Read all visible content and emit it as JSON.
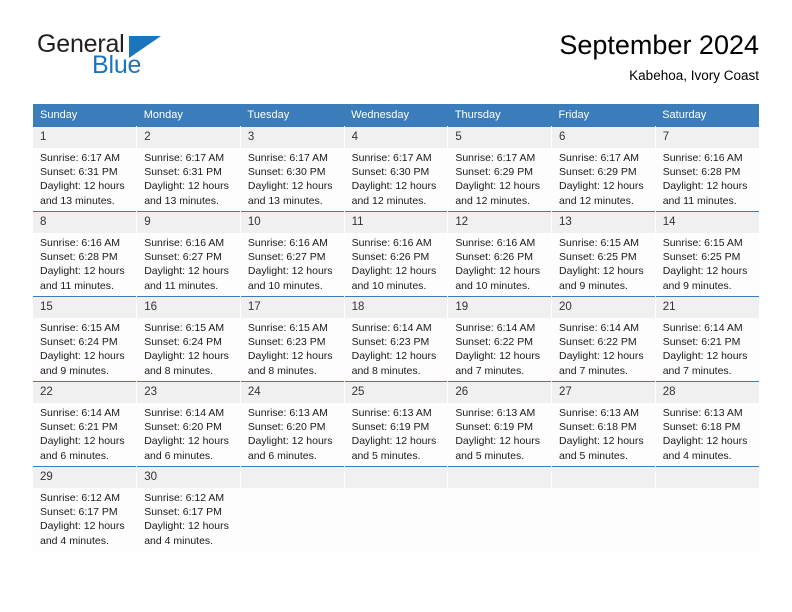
{
  "brand": {
    "name_top": "General",
    "name_bottom": "Blue",
    "accent_color": "#1b75bc",
    "triangle_icon": "logo-triangle-icon"
  },
  "header": {
    "title": "September 2024",
    "subtitle": "Kabehoa, Ivory Coast"
  },
  "calendar": {
    "header_background": "#3b7dba",
    "header_text_color": "#ffffff",
    "daynum_background": "#f0f0f0",
    "weekday_headers": [
      "Sunday",
      "Monday",
      "Tuesday",
      "Wednesday",
      "Thursday",
      "Friday",
      "Saturday"
    ],
    "weeks": [
      [
        {
          "day": "1",
          "sunrise": "Sunrise: 6:17 AM",
          "sunset": "Sunset: 6:31 PM",
          "daylight_1": "Daylight: 12 hours",
          "daylight_2": "and 13 minutes."
        },
        {
          "day": "2",
          "sunrise": "Sunrise: 6:17 AM",
          "sunset": "Sunset: 6:31 PM",
          "daylight_1": "Daylight: 12 hours",
          "daylight_2": "and 13 minutes."
        },
        {
          "day": "3",
          "sunrise": "Sunrise: 6:17 AM",
          "sunset": "Sunset: 6:30 PM",
          "daylight_1": "Daylight: 12 hours",
          "daylight_2": "and 13 minutes."
        },
        {
          "day": "4",
          "sunrise": "Sunrise: 6:17 AM",
          "sunset": "Sunset: 6:30 PM",
          "daylight_1": "Daylight: 12 hours",
          "daylight_2": "and 12 minutes."
        },
        {
          "day": "5",
          "sunrise": "Sunrise: 6:17 AM",
          "sunset": "Sunset: 6:29 PM",
          "daylight_1": "Daylight: 12 hours",
          "daylight_2": "and 12 minutes."
        },
        {
          "day": "6",
          "sunrise": "Sunrise: 6:17 AM",
          "sunset": "Sunset: 6:29 PM",
          "daylight_1": "Daylight: 12 hours",
          "daylight_2": "and 12 minutes."
        },
        {
          "day": "7",
          "sunrise": "Sunrise: 6:16 AM",
          "sunset": "Sunset: 6:28 PM",
          "daylight_1": "Daylight: 12 hours",
          "daylight_2": "and 11 minutes."
        }
      ],
      [
        {
          "day": "8",
          "sunrise": "Sunrise: 6:16 AM",
          "sunset": "Sunset: 6:28 PM",
          "daylight_1": "Daylight: 12 hours",
          "daylight_2": "and 11 minutes."
        },
        {
          "day": "9",
          "sunrise": "Sunrise: 6:16 AM",
          "sunset": "Sunset: 6:27 PM",
          "daylight_1": "Daylight: 12 hours",
          "daylight_2": "and 11 minutes."
        },
        {
          "day": "10",
          "sunrise": "Sunrise: 6:16 AM",
          "sunset": "Sunset: 6:27 PM",
          "daylight_1": "Daylight: 12 hours",
          "daylight_2": "and 10 minutes."
        },
        {
          "day": "11",
          "sunrise": "Sunrise: 6:16 AM",
          "sunset": "Sunset: 6:26 PM",
          "daylight_1": "Daylight: 12 hours",
          "daylight_2": "and 10 minutes."
        },
        {
          "day": "12",
          "sunrise": "Sunrise: 6:16 AM",
          "sunset": "Sunset: 6:26 PM",
          "daylight_1": "Daylight: 12 hours",
          "daylight_2": "and 10 minutes."
        },
        {
          "day": "13",
          "sunrise": "Sunrise: 6:15 AM",
          "sunset": "Sunset: 6:25 PM",
          "daylight_1": "Daylight: 12 hours",
          "daylight_2": "and 9 minutes."
        },
        {
          "day": "14",
          "sunrise": "Sunrise: 6:15 AM",
          "sunset": "Sunset: 6:25 PM",
          "daylight_1": "Daylight: 12 hours",
          "daylight_2": "and 9 minutes."
        }
      ],
      [
        {
          "day": "15",
          "sunrise": "Sunrise: 6:15 AM",
          "sunset": "Sunset: 6:24 PM",
          "daylight_1": "Daylight: 12 hours",
          "daylight_2": "and 9 minutes."
        },
        {
          "day": "16",
          "sunrise": "Sunrise: 6:15 AM",
          "sunset": "Sunset: 6:24 PM",
          "daylight_1": "Daylight: 12 hours",
          "daylight_2": "and 8 minutes."
        },
        {
          "day": "17",
          "sunrise": "Sunrise: 6:15 AM",
          "sunset": "Sunset: 6:23 PM",
          "daylight_1": "Daylight: 12 hours",
          "daylight_2": "and 8 minutes."
        },
        {
          "day": "18",
          "sunrise": "Sunrise: 6:14 AM",
          "sunset": "Sunset: 6:23 PM",
          "daylight_1": "Daylight: 12 hours",
          "daylight_2": "and 8 minutes."
        },
        {
          "day": "19",
          "sunrise": "Sunrise: 6:14 AM",
          "sunset": "Sunset: 6:22 PM",
          "daylight_1": "Daylight: 12 hours",
          "daylight_2": "and 7 minutes."
        },
        {
          "day": "20",
          "sunrise": "Sunrise: 6:14 AM",
          "sunset": "Sunset: 6:22 PM",
          "daylight_1": "Daylight: 12 hours",
          "daylight_2": "and 7 minutes."
        },
        {
          "day": "21",
          "sunrise": "Sunrise: 6:14 AM",
          "sunset": "Sunset: 6:21 PM",
          "daylight_1": "Daylight: 12 hours",
          "daylight_2": "and 7 minutes."
        }
      ],
      [
        {
          "day": "22",
          "sunrise": "Sunrise: 6:14 AM",
          "sunset": "Sunset: 6:21 PM",
          "daylight_1": "Daylight: 12 hours",
          "daylight_2": "and 6 minutes."
        },
        {
          "day": "23",
          "sunrise": "Sunrise: 6:14 AM",
          "sunset": "Sunset: 6:20 PM",
          "daylight_1": "Daylight: 12 hours",
          "daylight_2": "and 6 minutes."
        },
        {
          "day": "24",
          "sunrise": "Sunrise: 6:13 AM",
          "sunset": "Sunset: 6:20 PM",
          "daylight_1": "Daylight: 12 hours",
          "daylight_2": "and 6 minutes."
        },
        {
          "day": "25",
          "sunrise": "Sunrise: 6:13 AM",
          "sunset": "Sunset: 6:19 PM",
          "daylight_1": "Daylight: 12 hours",
          "daylight_2": "and 5 minutes."
        },
        {
          "day": "26",
          "sunrise": "Sunrise: 6:13 AM",
          "sunset": "Sunset: 6:19 PM",
          "daylight_1": "Daylight: 12 hours",
          "daylight_2": "and 5 minutes."
        },
        {
          "day": "27",
          "sunrise": "Sunrise: 6:13 AM",
          "sunset": "Sunset: 6:18 PM",
          "daylight_1": "Daylight: 12 hours",
          "daylight_2": "and 5 minutes."
        },
        {
          "day": "28",
          "sunrise": "Sunrise: 6:13 AM",
          "sunset": "Sunset: 6:18 PM",
          "daylight_1": "Daylight: 12 hours",
          "daylight_2": "and 4 minutes."
        }
      ],
      [
        {
          "day": "29",
          "sunrise": "Sunrise: 6:12 AM",
          "sunset": "Sunset: 6:17 PM",
          "daylight_1": "Daylight: 12 hours",
          "daylight_2": "and 4 minutes."
        },
        {
          "day": "30",
          "sunrise": "Sunrise: 6:12 AM",
          "sunset": "Sunset: 6:17 PM",
          "daylight_1": "Daylight: 12 hours",
          "daylight_2": "and 4 minutes."
        },
        {
          "day": "",
          "sunrise": "",
          "sunset": "",
          "daylight_1": "",
          "daylight_2": ""
        },
        {
          "day": "",
          "sunrise": "",
          "sunset": "",
          "daylight_1": "",
          "daylight_2": ""
        },
        {
          "day": "",
          "sunrise": "",
          "sunset": "",
          "daylight_1": "",
          "daylight_2": ""
        },
        {
          "day": "",
          "sunrise": "",
          "sunset": "",
          "daylight_1": "",
          "daylight_2": ""
        },
        {
          "day": "",
          "sunrise": "",
          "sunset": "",
          "daylight_1": "",
          "daylight_2": ""
        }
      ]
    ]
  }
}
